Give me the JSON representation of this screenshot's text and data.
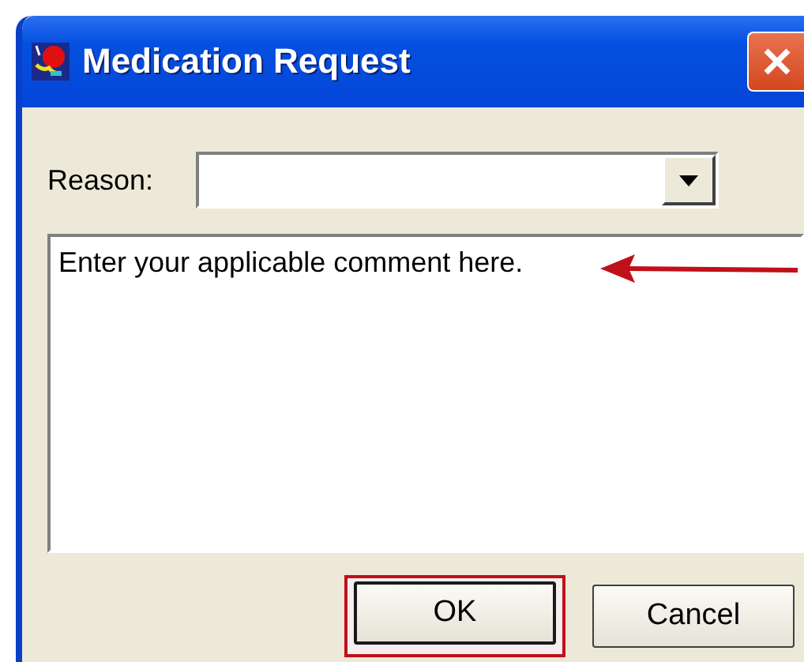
{
  "window": {
    "title": "Medication Request"
  },
  "reason": {
    "label": "Reason:"
  },
  "comment": {
    "value": "Enter your applicable comment here.",
    "annotated": true
  },
  "buttons": [
    {
      "label": "OK",
      "annotated": true
    },
    {
      "label": "Cancel",
      "annotated": false
    }
  ]
}
